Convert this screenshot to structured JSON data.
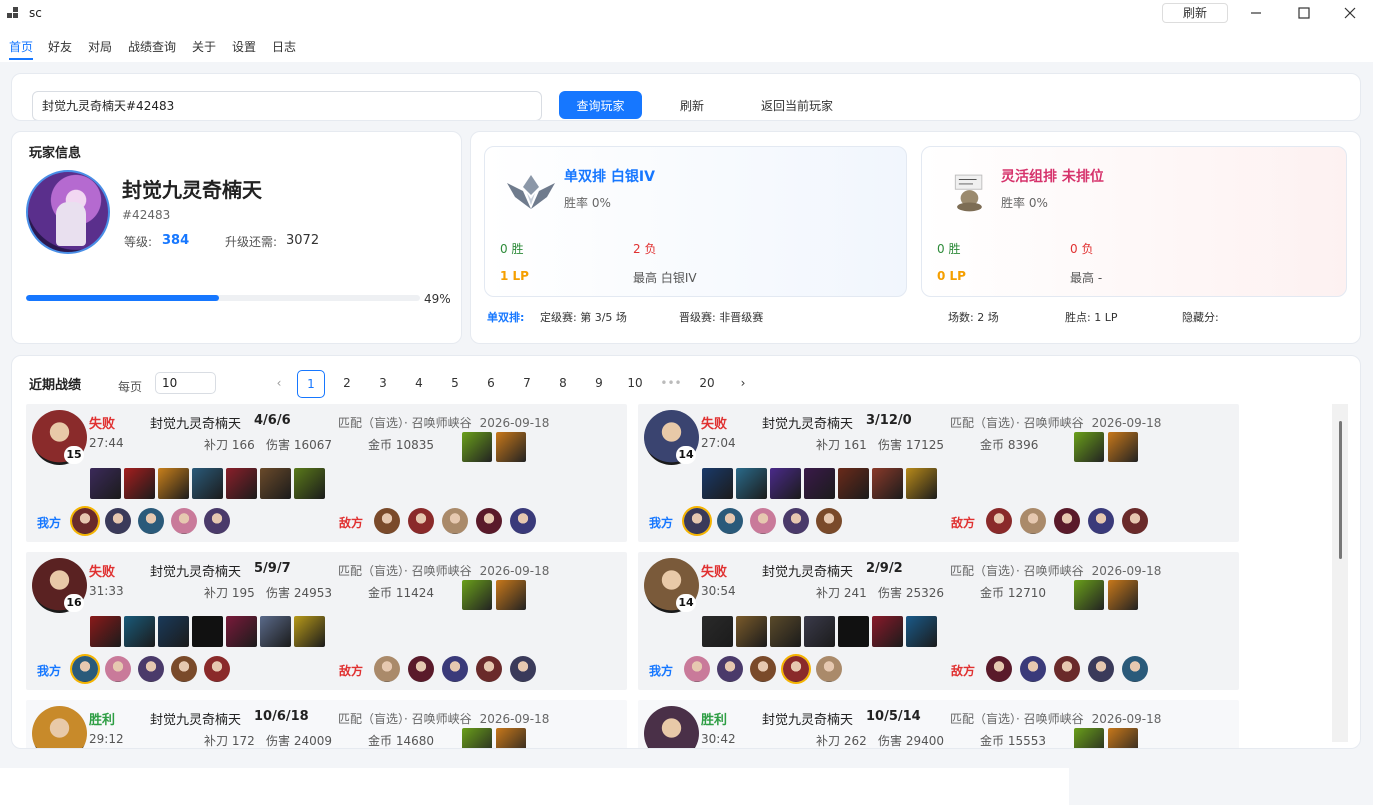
{
  "window": {
    "title": "sc",
    "refresh_label": "刷新"
  },
  "nav": {
    "items": [
      "首页",
      "好友",
      "对局",
      "战绩查询",
      "关于",
      "设置",
      "日志"
    ],
    "active": "首页"
  },
  "search": {
    "value": "封觉九灵奇楠天#42483",
    "query_label": "查询玩家",
    "refresh_label": "刷新",
    "back_label": "返回当前玩家"
  },
  "player": {
    "section_title": "玩家信息",
    "name": "封觉九灵奇楠天",
    "tag": "#42483",
    "level_label": "等级:",
    "level": "384",
    "next_label": "升级还需:",
    "next_value": "3072",
    "progress_percent": 49,
    "progress_label": "49%"
  },
  "rank": {
    "solo": {
      "title": "单双排 白银IV",
      "winrate": "胜率 0%",
      "wins": "0 胜",
      "losses": "2 负",
      "lp": "1 LP",
      "highest": "最高 白银IV",
      "title_color": "#1677ff"
    },
    "flex": {
      "title": "灵活组排 未排位",
      "winrate": "胜率 0%",
      "wins": "0 胜",
      "losses": "0 负",
      "lp": "0 LP",
      "highest": "最高 -",
      "title_color": "#d6336c"
    },
    "footer": {
      "queue_label": "单双排:",
      "placement": "定级赛: 第 3/5 场",
      "promo": "晋级赛: 非晋级赛",
      "games": "场数: 2 场",
      "lp": "胜点: 1 LP",
      "mmr": "隐藏分:"
    }
  },
  "matches": {
    "section_title": "近期战绩",
    "per_page_label": "每页",
    "per_page": "10",
    "pages": [
      "1",
      "2",
      "3",
      "4",
      "5",
      "6",
      "7",
      "8",
      "9",
      "10",
      "•••",
      "20"
    ],
    "current_page": "1",
    "ally_label": "我方",
    "enemy_label": "敌方",
    "list": [
      {
        "result": "失败",
        "outcome": "lose",
        "name": "封觉九灵奇楠天",
        "kda": "4/6/6",
        "mode": "匹配（盲选）· 召唤师峡谷",
        "date": "2026-09-18",
        "time": "27:44",
        "cs": "补刀 166",
        "damage": "伤害 16067",
        "gold": "金币 10835",
        "level": "15",
        "champ_color": "#8a2b2b"
      },
      {
        "result": "失败",
        "outcome": "lose",
        "name": "封觉九灵奇楠天",
        "kda": "3/12/0",
        "mode": "匹配（盲选）· 召唤师峡谷",
        "date": "2026-09-18",
        "time": "27:04",
        "cs": "补刀 161",
        "damage": "伤害 17125",
        "gold": "金币 8396",
        "level": "14",
        "champ_color": "#3a4470"
      },
      {
        "result": "失败",
        "outcome": "lose",
        "name": "封觉九灵奇楠天",
        "kda": "5/9/7",
        "mode": "匹配（盲选）· 召唤师峡谷",
        "date": "2026-09-18",
        "time": "31:33",
        "cs": "补刀 195",
        "damage": "伤害 24953",
        "gold": "金币 11424",
        "level": "16",
        "champ_color": "#5a2222"
      },
      {
        "result": "失败",
        "outcome": "lose",
        "name": "封觉九灵奇楠天",
        "kda": "2/9/2",
        "mode": "匹配（盲选）· 召唤师峡谷",
        "date": "2026-09-18",
        "time": "30:54",
        "cs": "补刀 241",
        "damage": "伤害 25326",
        "gold": "金币 12710",
        "level": "14",
        "champ_color": "#7a5a3a"
      },
      {
        "result": "胜利",
        "outcome": "win",
        "name": "封觉九灵奇楠天",
        "kda": "10/6/18",
        "mode": "匹配（盲选）· 召唤师峡谷",
        "date": "2026-09-18",
        "time": "29:12",
        "cs": "补刀 172",
        "damage": "伤害 24009",
        "gold": "金币 14680",
        "level": "",
        "champ_color": "#c88a2a"
      },
      {
        "result": "胜利",
        "outcome": "win",
        "name": "封觉九灵奇楠天",
        "kda": "10/5/14",
        "mode": "匹配（盲选）· 召唤师峡谷",
        "date": "2026-09-18",
        "time": "30:42",
        "cs": "补刀 262",
        "damage": "伤害 29400",
        "gold": "金币 15553",
        "level": "",
        "champ_color": "#4a3048"
      }
    ]
  },
  "colors": {
    "accent": "#1677ff",
    "lose": "#e03131",
    "win": "#2e9e44",
    "lp": "#f59f00"
  }
}
